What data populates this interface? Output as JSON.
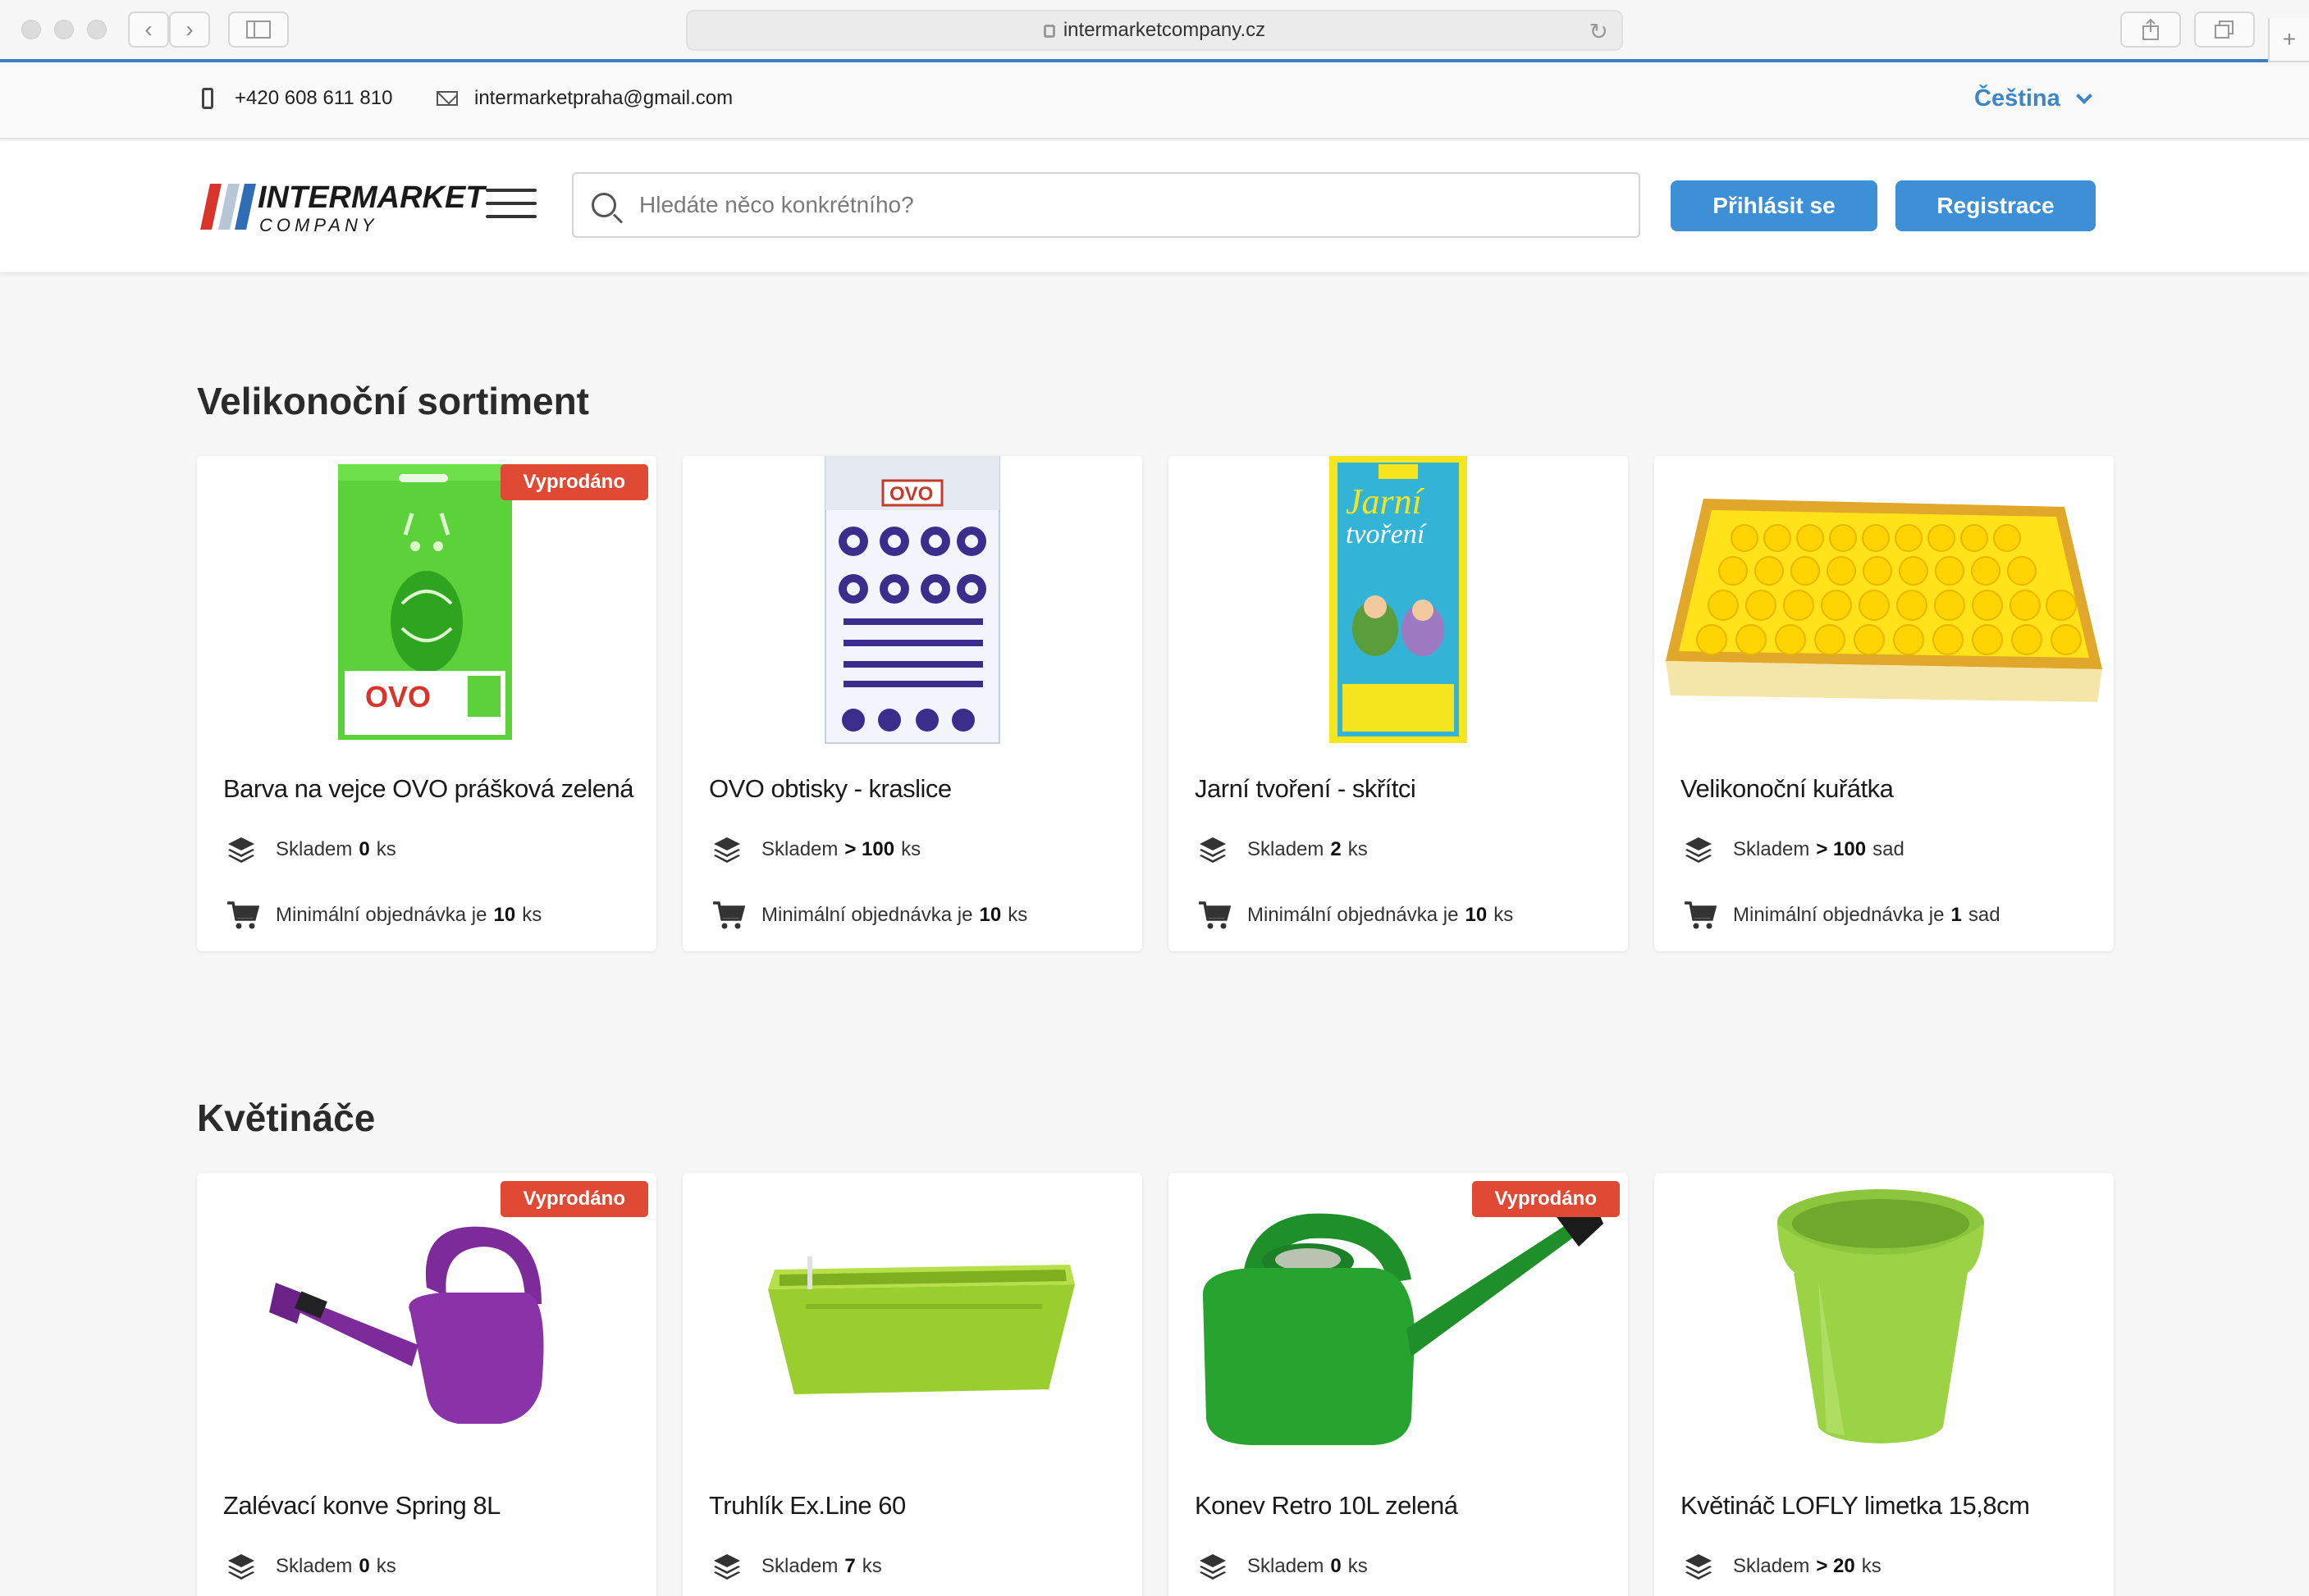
{
  "browser": {
    "url": "intermarketcompany.cz"
  },
  "contact": {
    "phone": "+420 608 611 810",
    "email": "intermarketpraha@gmail.com",
    "language": "Čeština"
  },
  "header": {
    "logo_line1": "INTERMARKET",
    "logo_line2": "COMPANY",
    "search_placeholder": "Hledáte něco konkrétního?",
    "login_label": "Přihlásit se",
    "register_label": "Registrace"
  },
  "sections": [
    {
      "title": "Velikonoční sortiment",
      "products": [
        {
          "name": "Barva na vejce OVO prášková zelená",
          "stock_label": "Skladem",
          "stock_value": "0",
          "stock_unit": "ks",
          "min_label": "Minimální objednávka je",
          "min_value": "10",
          "min_unit": "ks",
          "badge": "Vyprodáno",
          "image": "green-egg-dye-packet"
        },
        {
          "name": "OVO obtisky - kraslice",
          "stock_label": "Skladem",
          "stock_value": "> 100",
          "stock_unit": "ks",
          "min_label": "Minimální objednávka je",
          "min_value": "10",
          "min_unit": "ks",
          "badge": "",
          "image": "egg-decal-sheet"
        },
        {
          "name": "Jarní tvoření - skřítci",
          "stock_label": "Skladem",
          "stock_value": "2",
          "stock_unit": "ks",
          "min_label": "Minimální objednávka je",
          "min_value": "10",
          "min_unit": "ks",
          "badge": "",
          "image": "spring-craft-booklet"
        },
        {
          "name": "Velikonoční kuřátka",
          "stock_label": "Skladem",
          "stock_value": "> 100",
          "stock_unit": "sad",
          "min_label": "Minimální objednávka je",
          "min_value": "1",
          "min_unit": "sad",
          "badge": "",
          "image": "box-of-chicks"
        }
      ]
    },
    {
      "title": "Květináče",
      "products": [
        {
          "name": "Zalévací konve Spring 8L",
          "stock_label": "Skladem",
          "stock_value": "0",
          "stock_unit": "ks",
          "badge": "Vyprodáno",
          "image": "purple-watering-can"
        },
        {
          "name": "Truhlík Ex.Line 60",
          "stock_label": "Skladem",
          "stock_value": "7",
          "stock_unit": "ks",
          "badge": "",
          "image": "green-planter-box"
        },
        {
          "name": "Konev Retro 10L zelená",
          "stock_label": "Skladem",
          "stock_value": "0",
          "stock_unit": "ks",
          "badge": "Vyprodáno",
          "image": "green-watering-can"
        },
        {
          "name": "Květináč LOFLY limetka 15,8cm",
          "stock_label": "Skladem",
          "stock_value": "> 20",
          "stock_unit": "ks",
          "badge": "",
          "image": "lime-flower-pot"
        }
      ]
    }
  ],
  "colors": {
    "accent": "#3d8fd6",
    "badge": "#e04a35",
    "brand_red": "#d9342b",
    "brand_blue": "#2f6db5"
  }
}
